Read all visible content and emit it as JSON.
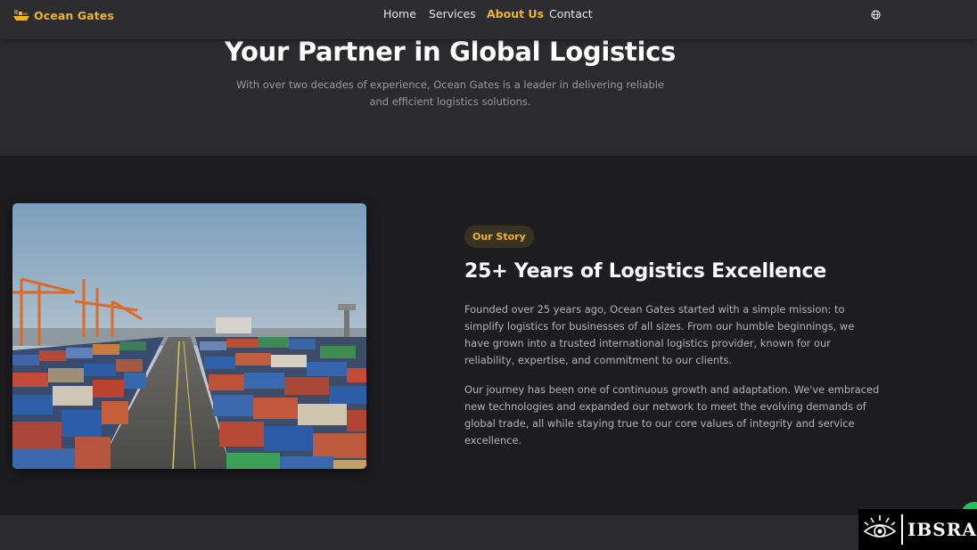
{
  "nav": {
    "brand": "Ocean Gates",
    "links": [
      "Home",
      "Services",
      "About Us",
      "Contact"
    ],
    "active_link": "About Us",
    "language_icon": "globe-icon"
  },
  "hero": {
    "title": "Your Partner in Global Logistics",
    "subtitle": "With over two decades of experience, Ocean Gates is a leader in delivering reliable and efficient logistics solutions."
  },
  "story": {
    "badge": "Our Story",
    "title": "25+ Years of Logistics Excellence",
    "paragraphs": [
      "Founded over 25 years ago, Ocean Gates started with a simple mission: to simplify logistics for businesses of all sizes. From our humble beginnings, we have grown into a trusted international logistics provider, known for our reliability, expertise, and commitment to our clients.",
      "Our journey has been one of continuous growth and adaptation. We've embraced new technologies and expanded our network to meet the evolving demands of global trade, all while staying true to our core values of integrity and service excellence."
    ]
  },
  "watermark": {
    "text": "IBSRA"
  },
  "colors": {
    "accent": "#f0b51f",
    "background": "#2b2b2d",
    "section_dark": "#1d1d20",
    "text_muted": "#b4b4b4"
  }
}
